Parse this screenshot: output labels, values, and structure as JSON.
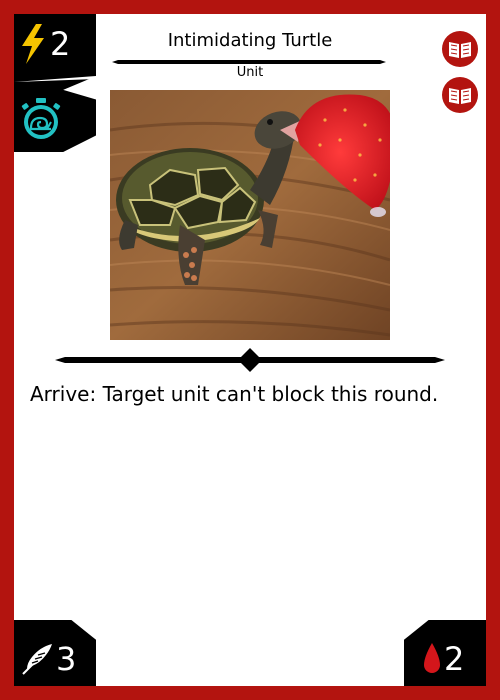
{
  "card": {
    "name": "Intimidating Turtle",
    "type": "Unit",
    "cost": "2",
    "power": "3",
    "health": "2",
    "rules_text": "Arrive: Target unit can't block this round.",
    "speed_icon": "snail-stopwatch-icon",
    "art": "turtle-biting-strawberry-illustration"
  },
  "colors": {
    "border": "#b3140f",
    "cost_bolt": "#f5c400",
    "speed_icon": "#22c1c3",
    "health_drop": "#d4161b",
    "book_badge": "#b3140f"
  },
  "badges": [
    {
      "icon": "open-book-icon"
    },
    {
      "icon": "open-book-icon"
    }
  ]
}
